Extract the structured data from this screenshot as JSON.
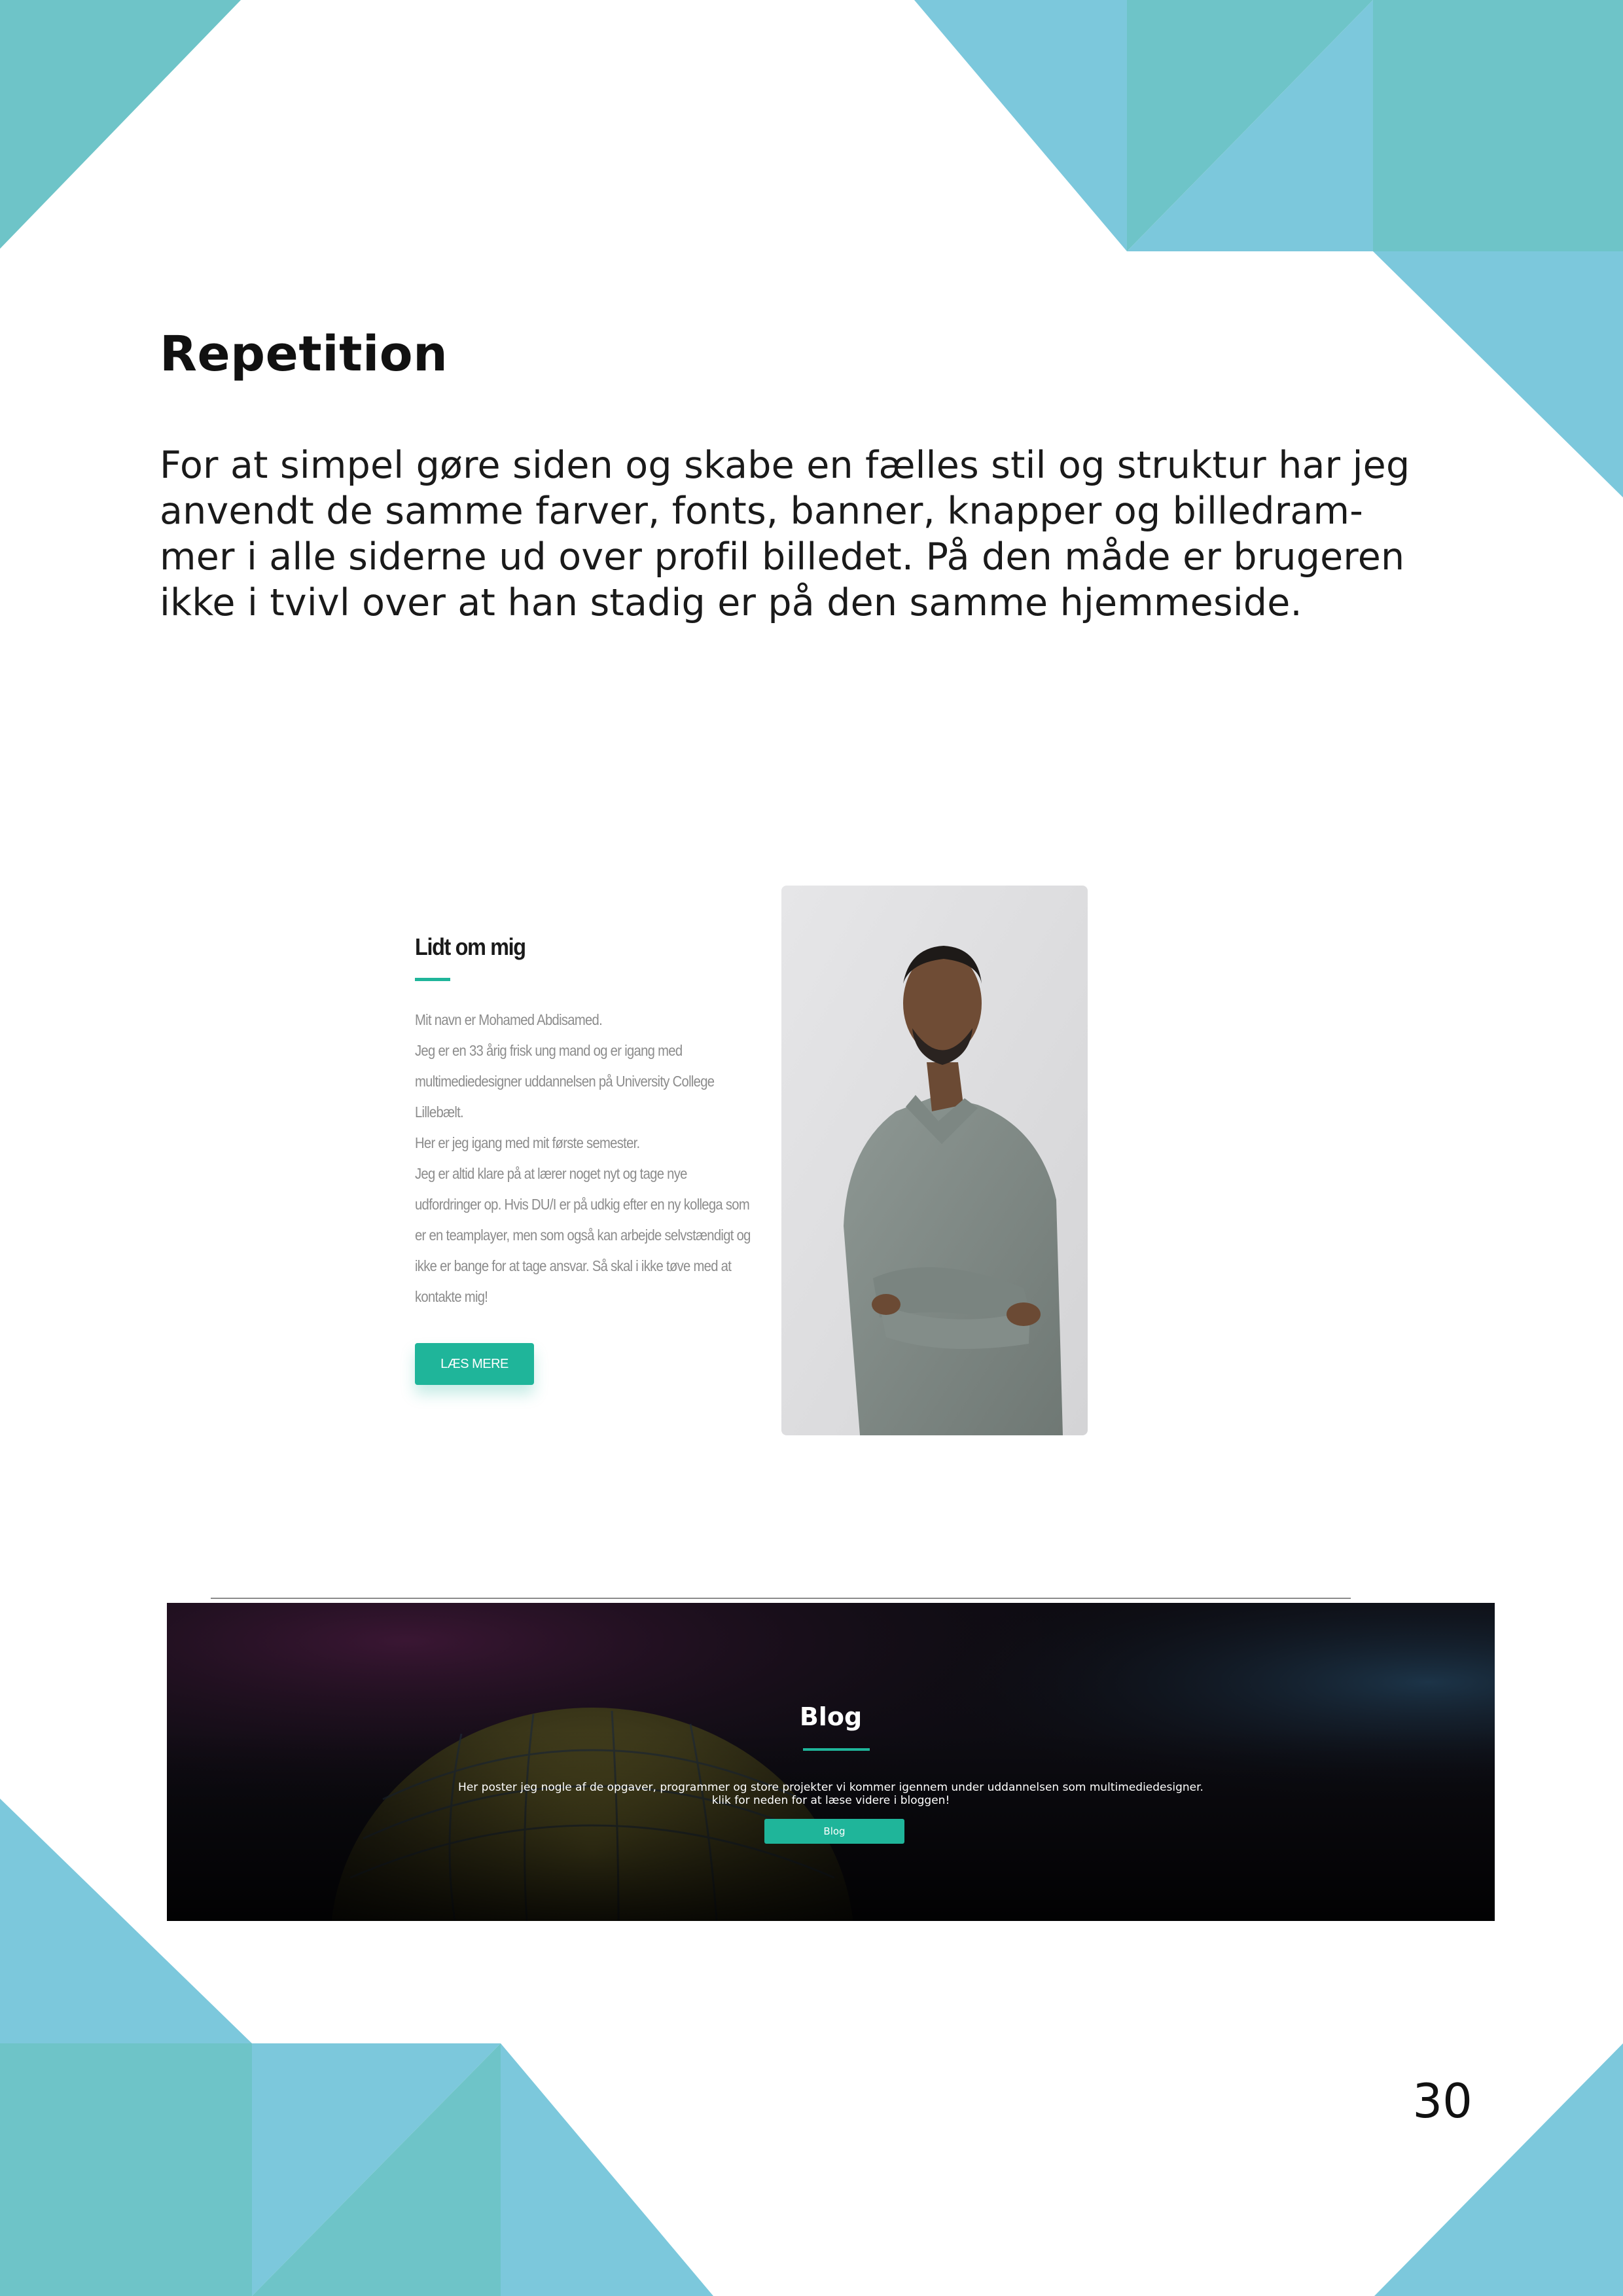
{
  "page": {
    "heading": "Repetition",
    "body_lines": [
      "For at simpel gøre siden og skabe en fælles stil og struktur har jeg",
      "anvendt de samme farver, fonts, banner, knapper og billedram-",
      "mer i alle siderne ud over profil billedet. På den måde er brugeren",
      "ikke i tvivl over at han stadig er på den samme hjemmeside."
    ],
    "page_number": "30"
  },
  "about": {
    "title": "Lidt om mig",
    "lines": [
      "Mit navn er Mohamed Abdisamed.",
      "Jeg er en 33 årig frisk ung mand og er igang med",
      "multimediedesigner uddannelsen på University College",
      "Lillebælt.",
      "Her er jeg igang med mit første semester.",
      "Jeg er altid klare på at lærer noget nyt og tage nye",
      "udfordringer op. Hvis DU/I er på udkig efter en ny kollega som",
      "er en teamplayer, men som også kan arbejde selvstændigt og",
      "ikke er bange for at tage ansvar. Så skal i ikke tøve med at",
      "kontakte mig!"
    ],
    "button_label": "LÆS MERE"
  },
  "blog": {
    "title": "Blog",
    "line1": "Her poster jeg nogle af de opgaver, programmer og store projekter vi kommer igennem under uddannelsen som multimediedesigner.",
    "line2": "klik for neden for at læse videre i bloggen!",
    "button_label": "Blog"
  },
  "colors": {
    "accent": "#1fb59a",
    "deco_teal": "#6ec4c8",
    "deco_blue": "#7cc8dc"
  }
}
